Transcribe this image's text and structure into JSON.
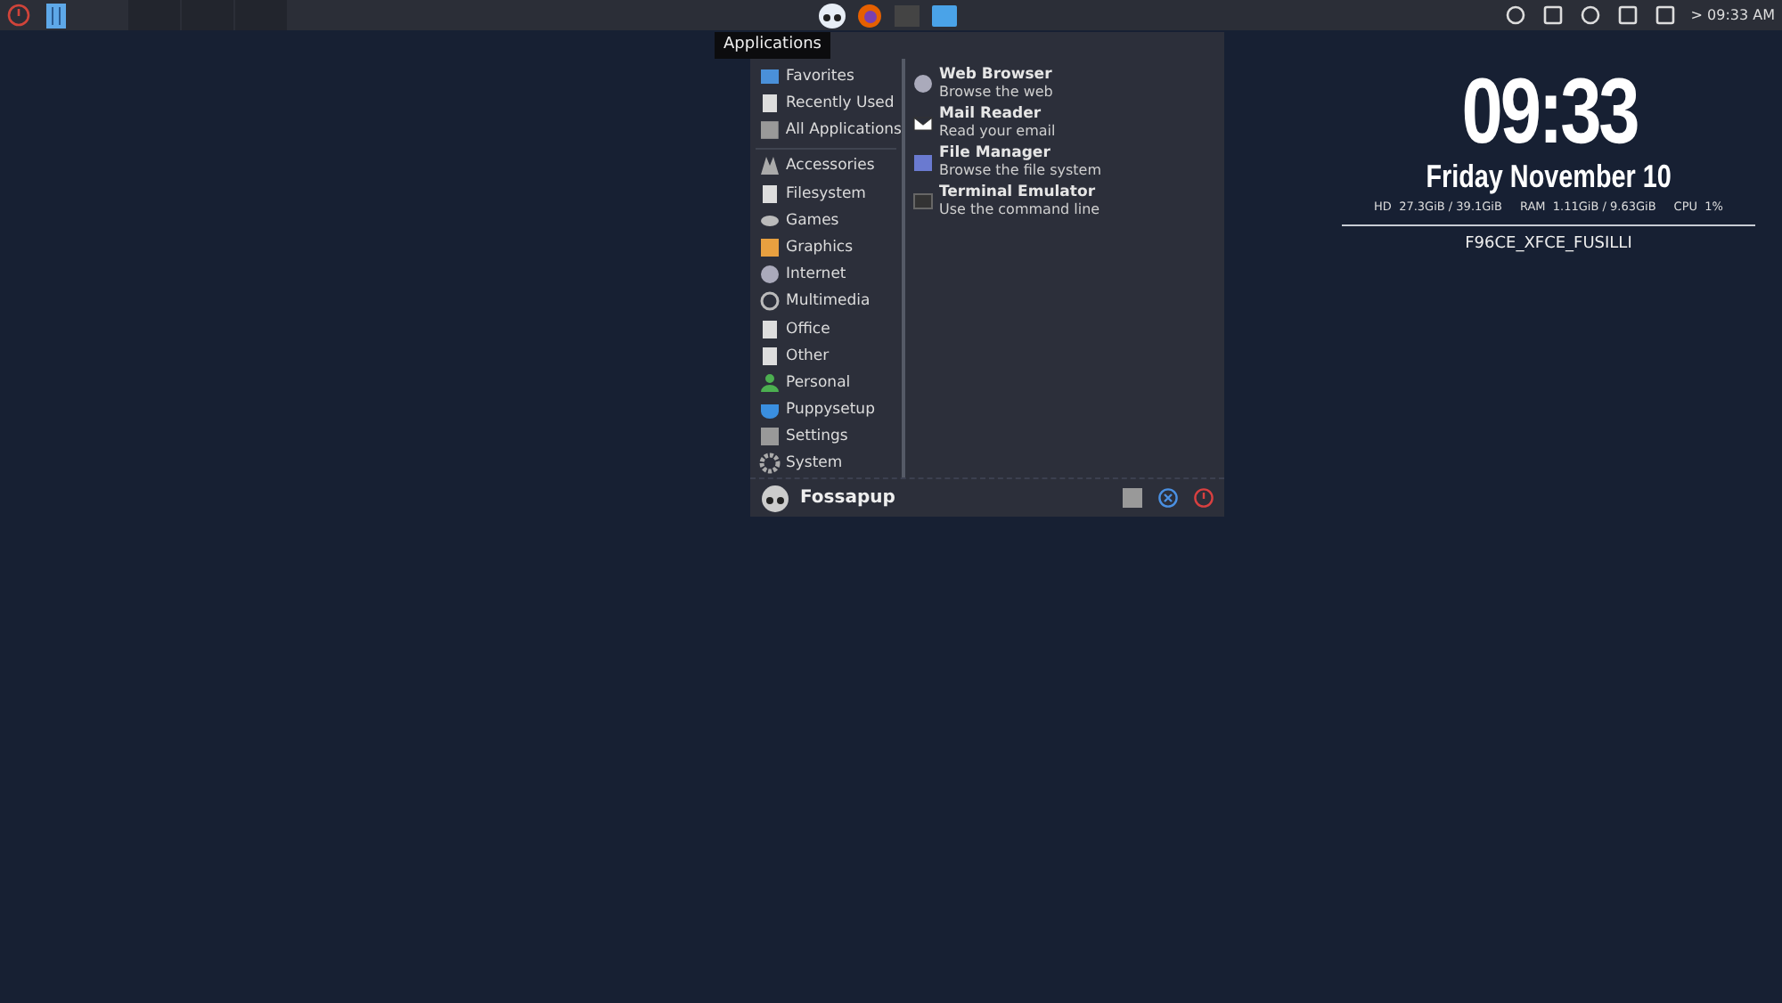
{
  "taskbar": {
    "workspaces": [
      {
        "selected": false
      },
      {
        "selected": false
      },
      {
        "selected": false
      }
    ],
    "tooltip": "Applications",
    "clock": "> 09:33 AM"
  },
  "menu": {
    "shortcuts": [
      {
        "label": "Favorites"
      },
      {
        "label": "Recently Used"
      },
      {
        "label": "All Applications"
      }
    ],
    "categories": [
      {
        "label": "Accessories"
      },
      {
        "label": "Filesystem"
      },
      {
        "label": "Games"
      },
      {
        "label": "Graphics"
      },
      {
        "label": "Internet"
      },
      {
        "label": "Multimedia"
      },
      {
        "label": "Office"
      },
      {
        "label": "Other"
      },
      {
        "label": "Personal"
      },
      {
        "label": "Puppysetup"
      },
      {
        "label": "Settings"
      },
      {
        "label": "System"
      }
    ],
    "apps": [
      {
        "name": "Web Browser",
        "description": "Browse the web"
      },
      {
        "name": "Mail Reader",
        "description": "Read your email"
      },
      {
        "name": "File Manager",
        "description": "Browse the file system"
      },
      {
        "name": "Terminal Emulator",
        "description": "Use the command line"
      }
    ],
    "user": "Fossapup"
  },
  "conky": {
    "time": "09:33",
    "date": "Friday November 10",
    "stats": [
      {
        "label": "HD",
        "value": "27.3GiB / 39.1GiB"
      },
      {
        "label": "RAM",
        "value": "1.11GiB / 9.63GiB"
      },
      {
        "label": "CPU",
        "value": "1%"
      }
    ],
    "hostname": "F96CE_XFCE_FUSILLI"
  }
}
